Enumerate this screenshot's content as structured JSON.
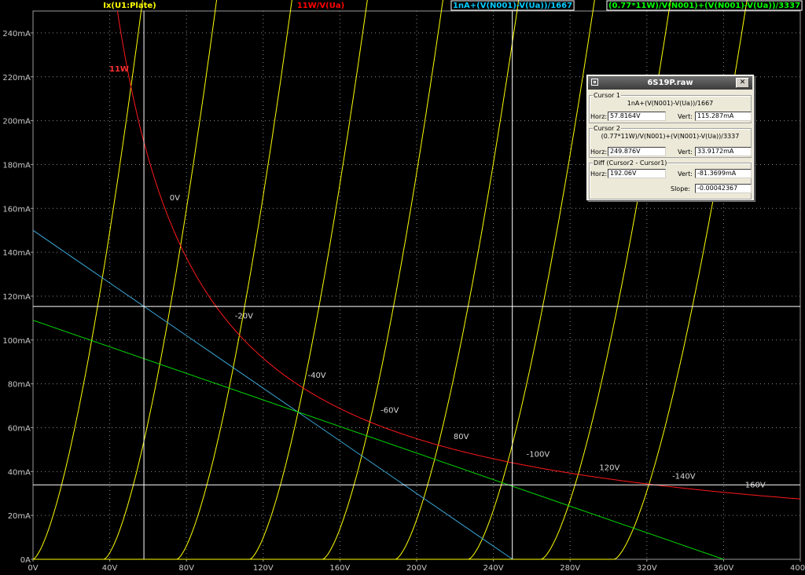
{
  "window": {
    "title": "6S19P.raw"
  },
  "trace_labels": [
    {
      "text": "Ix(U1:Plate)",
      "color": "#ffff00"
    },
    {
      "text": "11W/V(Ua)",
      "color": "#ff0000"
    },
    {
      "text": "1nA+(V(N001)-V(Ua))/1667",
      "color": "#00ccff"
    },
    {
      "text": "(0.77*11W)/V(N001)+(V(N001)-V(Ua))/3337",
      "color": "#00ff00"
    }
  ],
  "annotations": {
    "power_limit": "11W"
  },
  "chart_data": {
    "type": "line",
    "xlim": [
      0,
      400
    ],
    "ylim": [
      0,
      250
    ],
    "x_tick_labels": [
      "0V",
      "40V",
      "80V",
      "120V",
      "160V",
      "200V",
      "240V",
      "280V",
      "320V",
      "360V",
      "400V"
    ],
    "y_tick_labels": [
      "0A",
      "20mA",
      "40mA",
      "60mA",
      "80mA",
      "100mA",
      "120mA",
      "140mA",
      "160mA",
      "180mA",
      "200mA",
      "220mA",
      "240mA"
    ],
    "x_ticks": [
      0,
      40,
      80,
      120,
      160,
      200,
      240,
      280,
      320,
      360,
      400
    ],
    "y_ticks": [
      0,
      20,
      40,
      60,
      80,
      100,
      120,
      140,
      160,
      180,
      200,
      220,
      240
    ],
    "grid": true,
    "curve_family": [
      {
        "name": "0V",
        "offset": 0,
        "scale": 1.0,
        "label_at": [
          70,
          163
        ]
      },
      {
        "name": "-20V",
        "offset": 37,
        "scale": 0.96,
        "label_at": [
          104,
          109
        ]
      },
      {
        "name": "-40V",
        "offset": 75,
        "scale": 0.93,
        "label_at": [
          142,
          82
        ]
      },
      {
        "name": "-60V",
        "offset": 113,
        "scale": 0.9,
        "label_at": [
          180,
          66
        ]
      },
      {
        "name": "80V",
        "offset": 151,
        "scale": 0.87,
        "label_at": [
          218,
          54
        ]
      },
      {
        "name": "-100V",
        "offset": 189,
        "scale": 0.84,
        "label_at": [
          256,
          46
        ]
      },
      {
        "name": "120V",
        "offset": 227,
        "scale": 0.81,
        "label_at": [
          294,
          40
        ]
      },
      {
        "name": "-140V",
        "offset": 265,
        "scale": 0.78,
        "label_at": [
          332,
          36
        ]
      },
      {
        "name": "160V",
        "offset": 303,
        "scale": 0.75,
        "label_at": [
          370,
          32
        ]
      }
    ],
    "hyperbola_power_w": 11,
    "load_line_1": {
      "v0": 250,
      "i0": 150
    },
    "load_line_2": {
      "v0": 360,
      "i0": 109
    },
    "cursor1": {
      "x": 57.8164,
      "y": 115.287
    },
    "cursor2": {
      "x": 249.876,
      "y": 33.9172
    }
  },
  "cursor_panel": {
    "cursor1": {
      "legend": "Cursor 1",
      "expression": "1nA+(V(N001)-V(Ua))/1667",
      "horz_label": "Horz:",
      "horz_value": "57.8164V",
      "vert_label": "Vert:",
      "vert_value": "115.287mA"
    },
    "cursor2": {
      "legend": "Cursor 2",
      "expression": "(0.77*11W)/V(N001)+(V(N001)-V(Ua))/3337",
      "horz_label": "Horz:",
      "horz_value": "249.876V",
      "vert_label": "Vert:",
      "vert_value": "33.9172mA"
    },
    "diff": {
      "legend": "Diff (Cursor2 - Cursor1)",
      "horz_label": "Horz:",
      "horz_value": "192.06V",
      "vert_label": "Vert:",
      "vert_value": "-81.3699mA",
      "slope_label": "Slope:",
      "slope_value": "-0.00042367"
    }
  }
}
